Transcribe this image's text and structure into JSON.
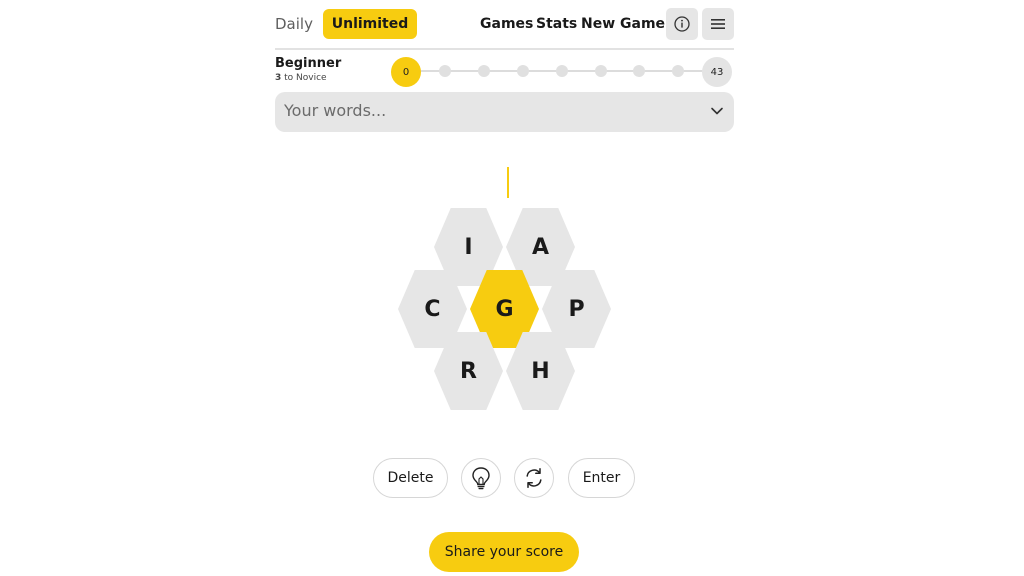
{
  "header": {
    "mode_tabs": [
      {
        "label": "Daily"
      },
      {
        "label": "Unlimited"
      }
    ],
    "nav": {
      "games": "Games",
      "stats": "Stats",
      "new_game": "New Game"
    },
    "icons": {
      "info": "info-icon",
      "menu": "hamburger-menu-icon"
    }
  },
  "progress": {
    "rank": "Beginner",
    "points_to_next": "3",
    "next_rank_suffix": "to Novice",
    "score": "0",
    "max_score": "43"
  },
  "words": {
    "placeholder": "Your words..."
  },
  "puzzle": {
    "center_letter": "G",
    "outer_letters": [
      "I",
      "A",
      "C",
      "P",
      "R",
      "H"
    ]
  },
  "actions": {
    "delete": "Delete",
    "enter": "Enter",
    "hint_icon": "lightbulb-icon",
    "shuffle_icon": "shuffle-icon",
    "share": "Share your score"
  },
  "colors": {
    "accent": "#f7cc10",
    "tile": "#e6e6e6"
  }
}
